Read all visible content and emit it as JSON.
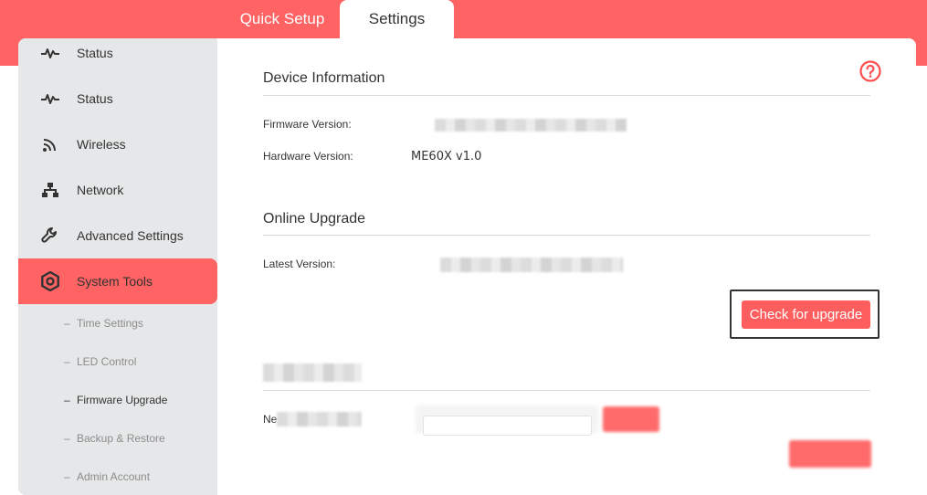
{
  "tabs": {
    "quick_setup": "Quick Setup",
    "settings": "Settings"
  },
  "sidebar": {
    "items": [
      {
        "label": "Status",
        "icon": "pulse-icon"
      },
      {
        "label": "Status",
        "icon": "pulse-icon"
      },
      {
        "label": "Wireless",
        "icon": "wifi-icon"
      },
      {
        "label": "Network",
        "icon": "network-icon"
      },
      {
        "label": "Advanced Settings",
        "icon": "wrench-icon"
      },
      {
        "label": "System Tools",
        "icon": "gear-icon",
        "active": true
      }
    ],
    "sub_items": [
      {
        "label": "Time Settings"
      },
      {
        "label": "LED Control"
      },
      {
        "label": "Firmware Upgrade",
        "current": true
      },
      {
        "label": "Backup & Restore"
      },
      {
        "label": "Admin Account"
      }
    ]
  },
  "device_info": {
    "title": "Device Information",
    "firmware_label": "Firmware Version:",
    "hardware_label": "Hardware Version:",
    "hardware_value": "ME60X v1.0"
  },
  "online_upgrade": {
    "title": "Online Upgrade",
    "latest_label": "Latest Version:",
    "check_button": "Check for upgrade"
  },
  "local_upgrade": {
    "new_label_prefix": "Ne"
  },
  "colors": {
    "accent": "#ff6363",
    "sidebar_bg": "#e6e7e8",
    "button": "#ff5e5e"
  }
}
